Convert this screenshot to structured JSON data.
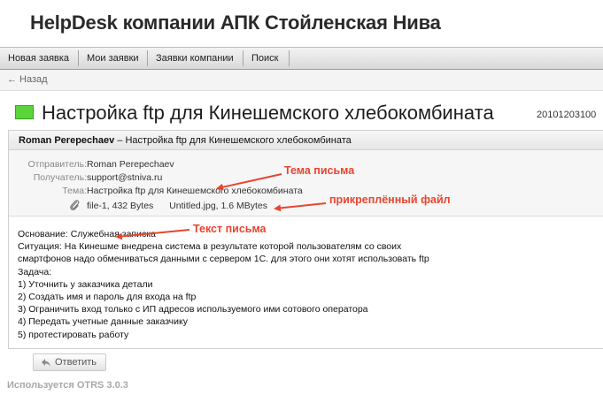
{
  "header": {
    "title": "HelpDesk компании АПК Стойленская Нива"
  },
  "nav": {
    "items": [
      "Новая заявка",
      "Мои заявки",
      "Заявки компании",
      "Поиск"
    ]
  },
  "back": {
    "label": "← Назад"
  },
  "ticket": {
    "title": "Настройка ftp для Кинешемского хлебокомбината",
    "number": "20101203100",
    "status_color": "#5bd43a"
  },
  "article": {
    "header_sender": "Roman Perepechaev",
    "header_rest": " – Настройка ftp для Кинешемского хлебокомбината",
    "meta": [
      {
        "label": "Отправитель:",
        "value": "Roman Perepechaev"
      },
      {
        "label": "Получатель:",
        "value": "support@stniva.ru"
      },
      {
        "label": "Тема:",
        "value": "Настройка ftp для Кинешемского хлебокомбината"
      }
    ],
    "attachments": [
      {
        "name": "file-1",
        "size": ", 432 Bytes"
      },
      {
        "name": "Untitled.jpg",
        "size": ", 1.6 MBytes"
      }
    ],
    "body_lines": [
      "Основание: Служебная записка",
      "Ситуация: На Кинешме внедрена система в результате которой пользователям со своих",
      "смартфонов надо обмениваться данными с сервером 1С. для этого они хотят использовать ftp",
      "Задача:",
      "1) Уточнить у заказчика детали",
      "2) Создать имя и пароль для входа на ftp",
      "3) Ограничить вход только с ИП адресов используемого ими сотового оператора",
      "4) Передать учетные данные заказчику",
      "5) протестировать работу"
    ]
  },
  "reply": {
    "label": "Ответить"
  },
  "footer": {
    "text": "Используется OTRS 3.0.3"
  },
  "annotations": {
    "subject": "Тема письма",
    "attachment": "прикреплённый файл",
    "body": "Текст письма",
    "color": "#e8452e"
  }
}
